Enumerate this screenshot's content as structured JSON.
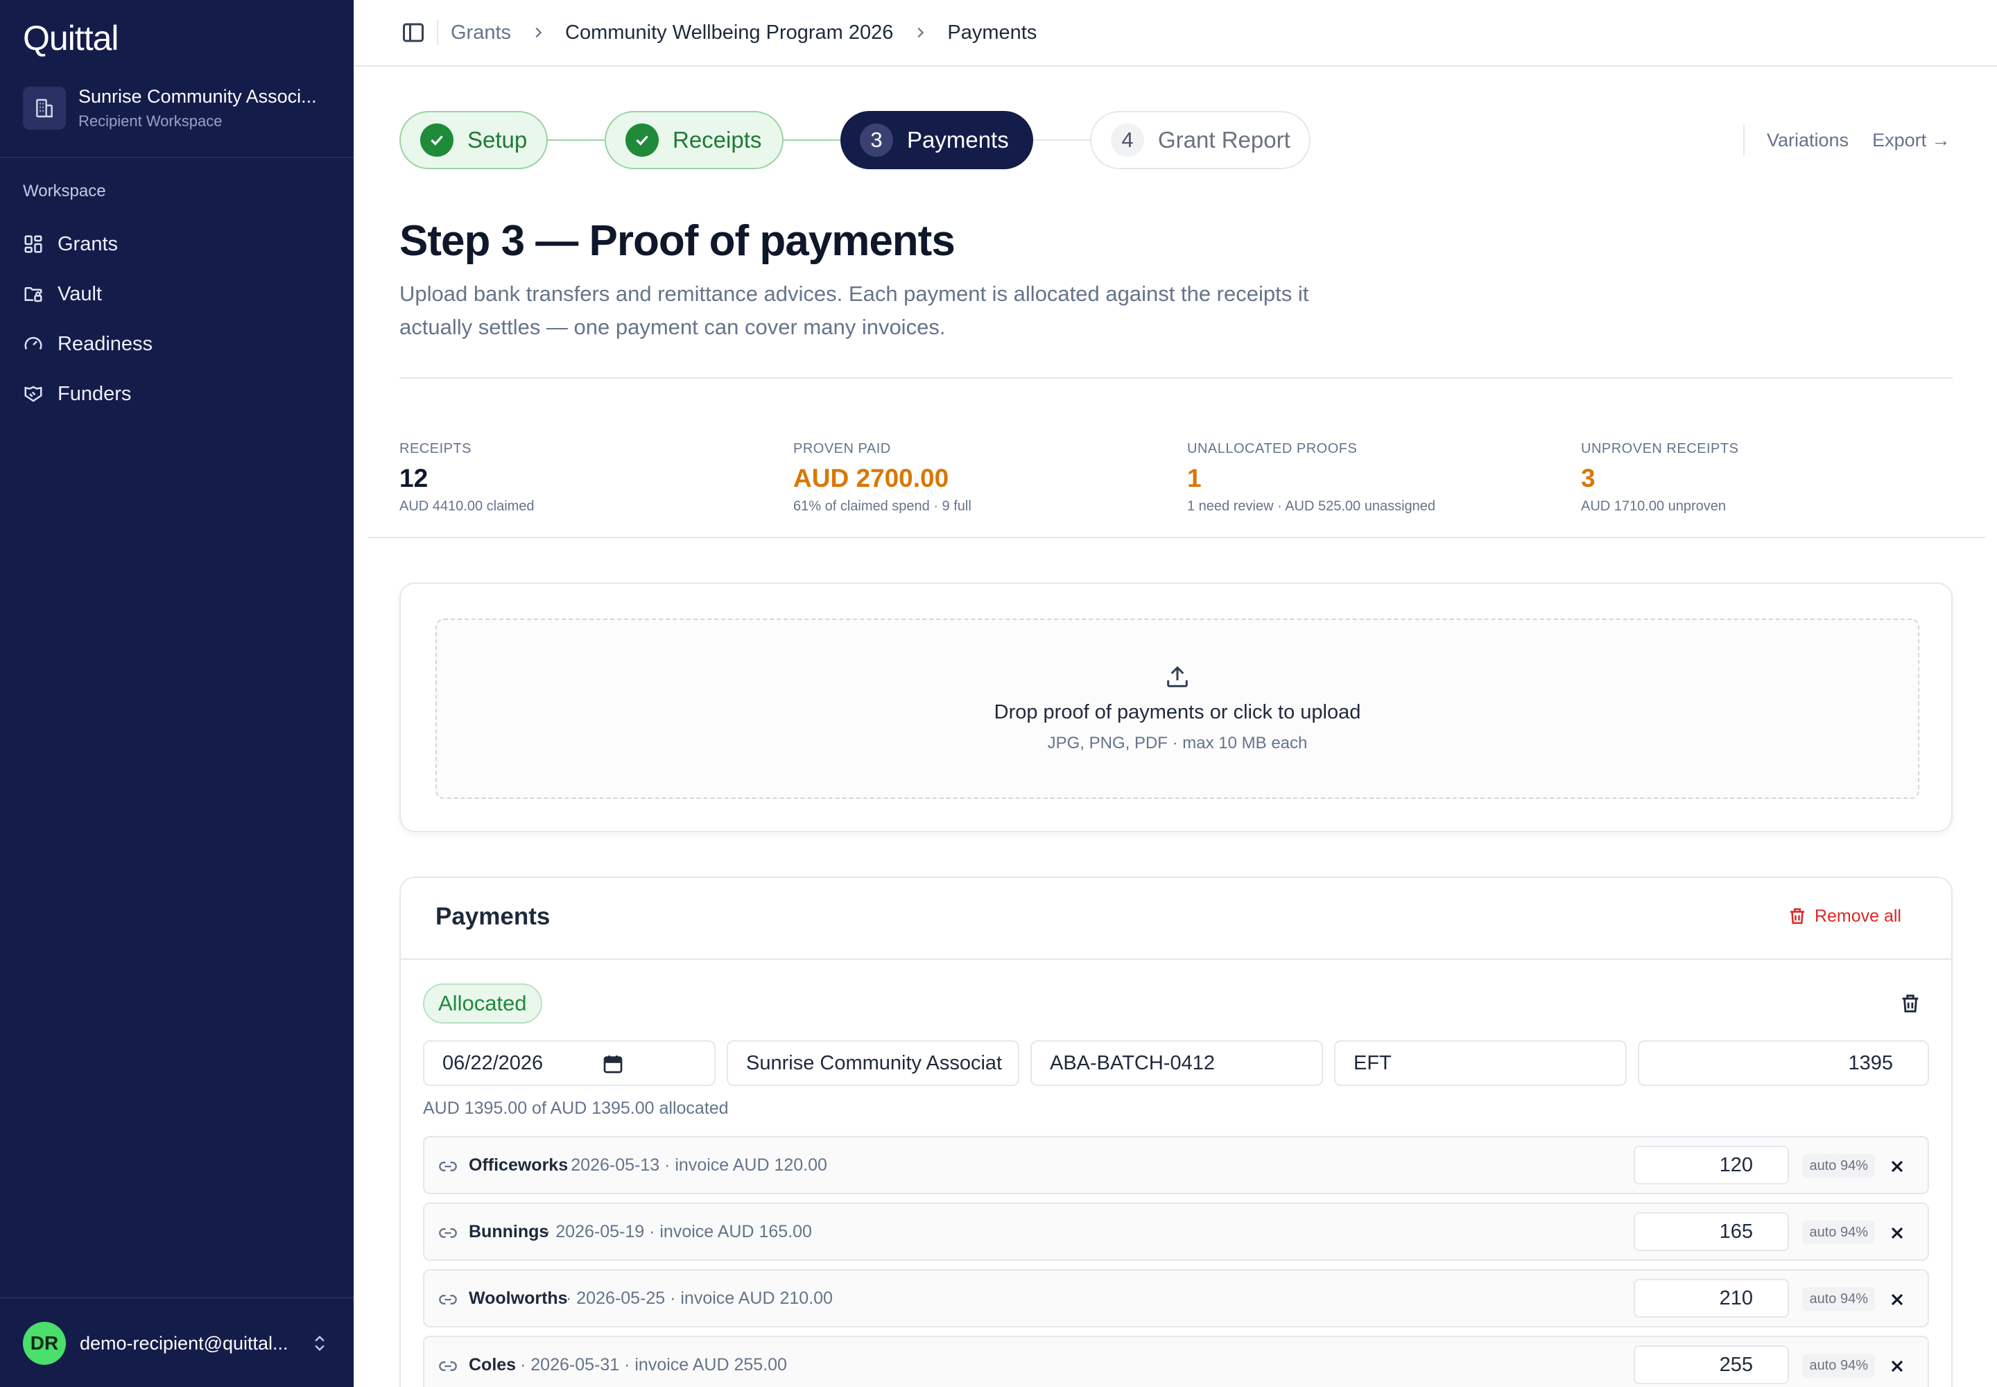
{
  "app": {
    "logo": "Quittal"
  },
  "sidebar": {
    "org_name": "Sunrise Community Associ...",
    "org_sub": "Recipient Workspace",
    "section": "Workspace",
    "items": [
      {
        "label": "Grants",
        "icon": "grid-icon"
      },
      {
        "label": "Vault",
        "icon": "vault-icon"
      },
      {
        "label": "Readiness",
        "icon": "gauge-icon"
      },
      {
        "label": "Funders",
        "icon": "handshake-icon"
      }
    ],
    "user": {
      "initials": "DR",
      "email": "demo-recipient@quittal..."
    }
  },
  "breadcrumb": [
    "Grants",
    "Community Wellbeing Program 2026",
    "Payments"
  ],
  "stepper": {
    "steps": [
      {
        "num": "1",
        "label": "Setup",
        "state": "done"
      },
      {
        "num": "2",
        "label": "Receipts",
        "state": "done"
      },
      {
        "num": "3",
        "label": "Payments",
        "state": "active"
      },
      {
        "num": "4",
        "label": "Grant Report",
        "state": "todo"
      }
    ],
    "actions": {
      "variations": "Variations",
      "export": "Export →"
    }
  },
  "page": {
    "title": "Step 3 — Proof of payments",
    "lead": "Upload bank transfers and remittance advices. Each payment is allocated against the receipts it actually settles — one payment can cover many invoices."
  },
  "stats": [
    {
      "label": "RECEIPTS",
      "value": "12",
      "sub": "AUD 4410.00 claimed",
      "accent": false
    },
    {
      "label": "PROVEN PAID",
      "value": "AUD 2700.00",
      "sub": "61% of claimed spend · 9 full",
      "accent": true
    },
    {
      "label": "UNALLOCATED PROOFS",
      "value": "1",
      "sub": "1 need review · AUD 525.00 unassigned",
      "accent": true
    },
    {
      "label": "UNPROVEN RECEIPTS",
      "value": "3",
      "sub": "AUD 1710.00 unproven",
      "accent": true
    }
  ],
  "upload": {
    "title": "Drop proof of payments or click to upload",
    "sub": "JPG, PNG, PDF · max 10 MB each"
  },
  "payments": {
    "title": "Payments",
    "remove_all": "Remove all",
    "entry": {
      "status": "Allocated",
      "date": "06/22/2026",
      "payer": "Sunrise Community Associat",
      "reference": "ABA-BATCH-0412",
      "method": "EFT",
      "amount": "1395",
      "allocation_note": "AUD 1395.00 of AUD 1395.00 allocated",
      "allocations": [
        {
          "vendor": "Officeworks",
          "meta": "· 2026-05-13 · invoice AUD 120.00",
          "amount": "120",
          "confidence": "auto 94%"
        },
        {
          "vendor": "Bunnings",
          "meta": "· 2026-05-19 · invoice AUD 165.00",
          "amount": "165",
          "confidence": "auto 94%"
        },
        {
          "vendor": "Woolworths",
          "meta": "· 2026-05-25 · invoice AUD 210.00",
          "amount": "210",
          "confidence": "auto 94%"
        },
        {
          "vendor": "Coles",
          "meta": "· 2026-05-31 · invoice AUD 255.00",
          "amount": "255",
          "confidence": "auto 94%"
        }
      ]
    }
  },
  "colors": {
    "sidebar": "#141c4a",
    "accent_orange": "#d97706",
    "success": "#1f8a3a",
    "danger": "#dc2626"
  }
}
